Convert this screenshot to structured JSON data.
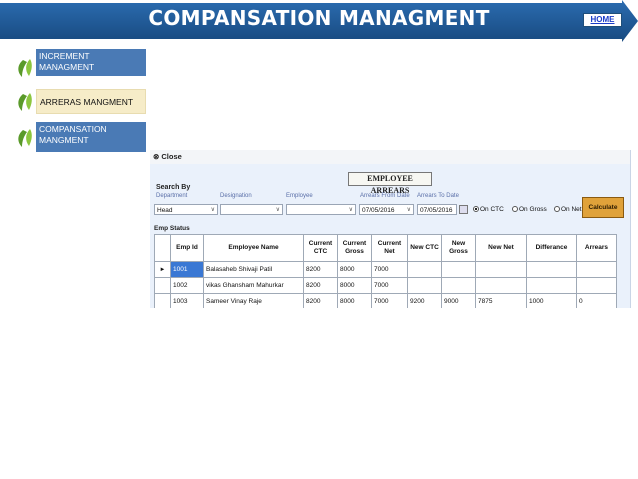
{
  "header": {
    "title": "COMPANSATION MANAGMENT",
    "home_label": "HOME"
  },
  "colors": {
    "banner": "#1f5a96",
    "menu_blue": "#4a7ab5",
    "menu_active": "#f6ecc8",
    "calc_button": "#e0a23a",
    "selected_cell": "#3a78d4"
  },
  "menu": {
    "items": [
      {
        "label": "INCREMENT MANAGMENT",
        "icon": "leaf-icon"
      },
      {
        "label": "ARRERAS MANGMENT",
        "icon": "leaf-icon"
      },
      {
        "label": "COMPANSATION MANGMENT",
        "icon": "leaf-icon"
      }
    ]
  },
  "window": {
    "close_label": "Close",
    "title": "EMPLOYEE ARREARS",
    "search_by": "Search By",
    "labels": {
      "department": "Department",
      "designation": "Designation",
      "employee": "Employee",
      "from_date": "Arrears From Date",
      "to_date": "Arrears To Date"
    },
    "values": {
      "department": "Head",
      "designation": "",
      "employee": "",
      "from_date": "07/05/2016",
      "to_date": "07/05/2016"
    },
    "radios": {
      "on_ctc": "On CTC",
      "on_gross": "On Gross",
      "on_net": "On Net",
      "selected": "On CTC"
    },
    "calculate_label": "Calculate",
    "emp_status_label": "Emp Status"
  },
  "grid": {
    "columns": [
      "Emp Id",
      "Employee Name",
      "Current CTC",
      "Current Gross",
      "Current Net",
      "New CTC",
      "New Gross",
      "New Net",
      "Differance",
      "Arrears"
    ],
    "rows": [
      [
        "1001",
        "Balasaheb  Shivaji Patil",
        "8200",
        "8000",
        "7000",
        "",
        "",
        "",
        "",
        ""
      ],
      [
        "1002",
        "vikas Ghansham Mahurkar",
        "8200",
        "8000",
        "7000",
        "",
        "",
        "",
        "",
        ""
      ],
      [
        "1003",
        "Sameer Vinay Raje",
        "8200",
        "8000",
        "7000",
        "9200",
        "9000",
        "7875",
        "1000",
        "0"
      ]
    ]
  }
}
